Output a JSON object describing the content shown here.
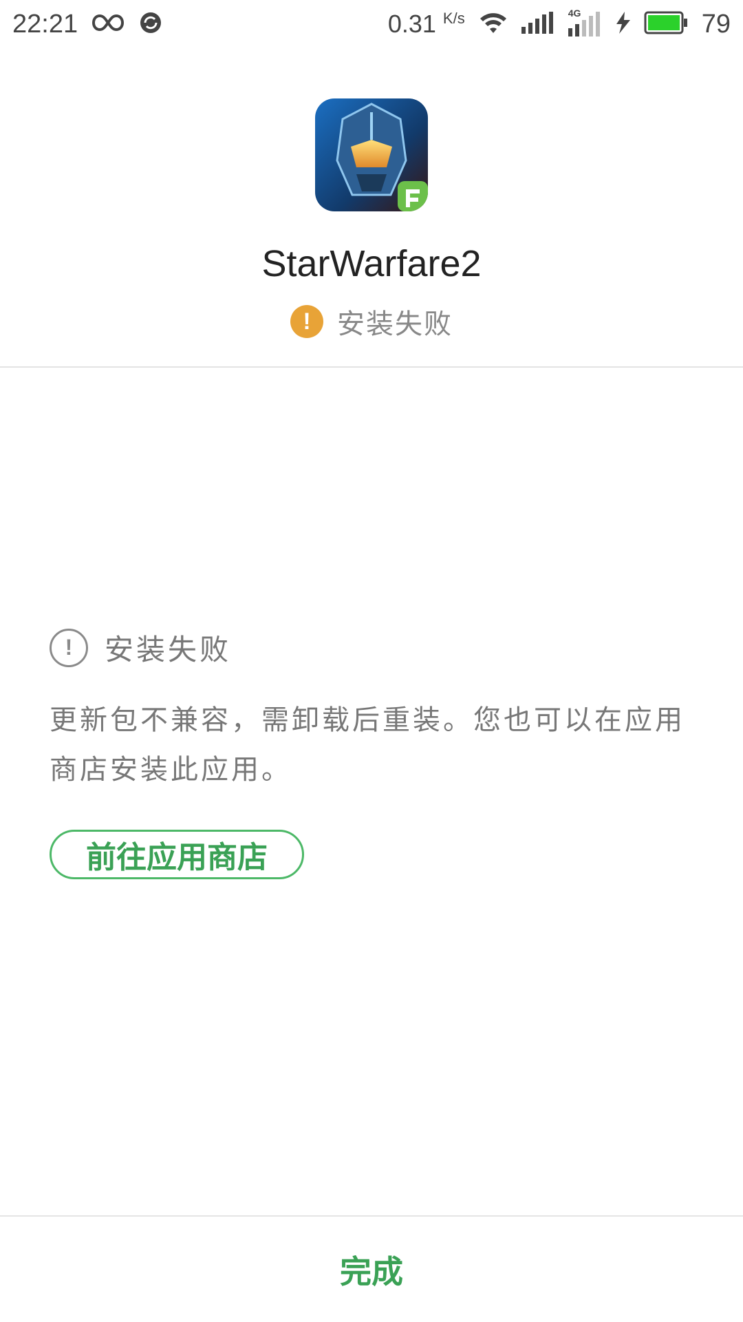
{
  "status_bar": {
    "time": "22:21",
    "speed": "0.31",
    "speed_unit": "K/s",
    "network_label": "4G",
    "battery_percent": "79",
    "battery_color": "#2bd12b"
  },
  "app": {
    "name": "StarWarfare2",
    "status": "安装失败",
    "status_color": "#e8a337"
  },
  "error": {
    "title": "安装失败",
    "message": "更新包不兼容，需卸载后重装。您也可以在应用商店安装此应用。"
  },
  "actions": {
    "store_button_label": "前往应用商店",
    "done_label": "完成",
    "accent_color": "#3aa155"
  }
}
